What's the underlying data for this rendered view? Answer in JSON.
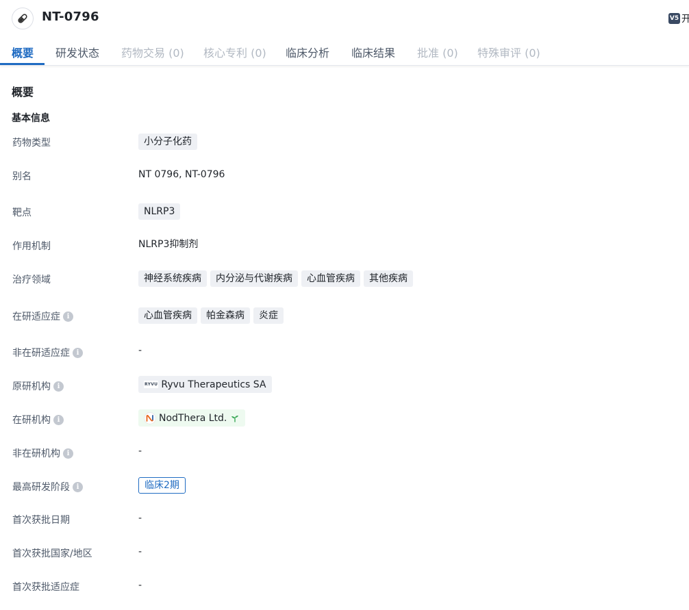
{
  "header": {
    "title": "NT-0796",
    "drug_icon": "pill-icon",
    "ai_badge": "V5",
    "ai_text": "开"
  },
  "tabs": [
    {
      "label": "概要",
      "state": "active"
    },
    {
      "label": "研发状态",
      "state": "normal"
    },
    {
      "label": "药物交易 (0)",
      "state": "disabled"
    },
    {
      "label": "核心专利 (0)",
      "state": "disabled"
    },
    {
      "label": "临床分析",
      "state": "normal"
    },
    {
      "label": "临床结果",
      "state": "normal"
    },
    {
      "label": "批准 (0)",
      "state": "disabled"
    },
    {
      "label": "特殊审评 (0)",
      "state": "disabled"
    }
  ],
  "overview": {
    "section_title": "概要",
    "basic_info_title": "基本信息",
    "fields": {
      "drug_type": {
        "label": "药物类型",
        "tags": [
          "小分子化药"
        ]
      },
      "alias": {
        "label": "别名",
        "value": "NT 0796,  NT-0796"
      },
      "target": {
        "label": "靶点",
        "tags": [
          "NLRP3"
        ]
      },
      "mechanism": {
        "label": "作用机制",
        "value": "NLRP3抑制剂"
      },
      "therapeutic_area": {
        "label": "治疗领域",
        "tags": [
          "神经系统疾病",
          "内分泌与代谢疾病",
          "心血管疾病",
          "其他疾病"
        ]
      },
      "active_indication": {
        "label": "在研适应症",
        "tags": [
          "心血管疾病",
          "帕金森病",
          "炎症"
        ]
      },
      "inactive_indication": {
        "label": "非在研适应症",
        "value": "-"
      },
      "originator": {
        "label": "原研机构",
        "org": "Ryvu Therapeutics SA",
        "logo_text": "RYVU"
      },
      "active_org": {
        "label": "在研机构",
        "org": "NodThera Ltd."
      },
      "inactive_org": {
        "label": "非在研机构",
        "value": "-"
      },
      "highest_phase": {
        "label": "最高研发阶段",
        "value": "临床2期"
      },
      "first_approval_date": {
        "label": "首次获批日期",
        "value": "-"
      },
      "first_approval_country": {
        "label": "首次获批国家/地区",
        "value": "-"
      },
      "first_approval_indication": {
        "label": "首次获批适应症",
        "value": "-"
      }
    }
  },
  "colors": {
    "accent": "#1f6bc2",
    "tag_bg": "#eef0f4",
    "green_tag_bg": "#eefaf0",
    "muted_text": "#b1b8c2"
  }
}
